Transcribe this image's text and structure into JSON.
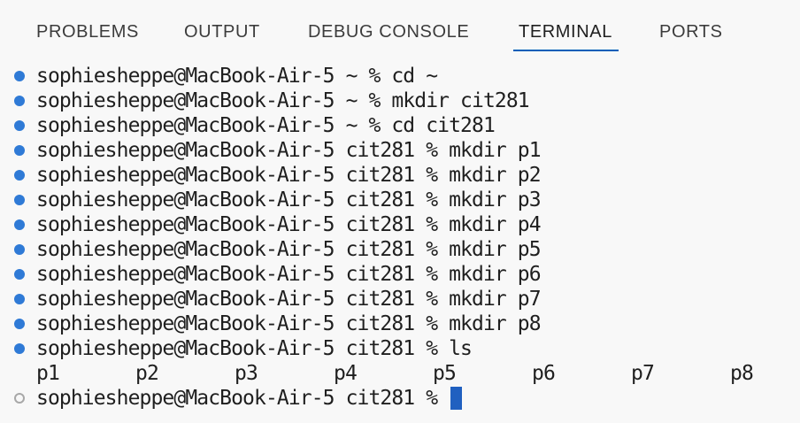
{
  "tabs": [
    {
      "label": "PROBLEMS"
    },
    {
      "label": "OUTPUT"
    },
    {
      "label": "DEBUG CONSOLE"
    },
    {
      "label": "TERMINAL",
      "active": true
    },
    {
      "label": "PORTS"
    }
  ],
  "terminal": {
    "lines": [
      "sophiesheppe@MacBook-Air-5 ~ % cd ~",
      "sophiesheppe@MacBook-Air-5 ~ % mkdir cit281",
      "sophiesheppe@MacBook-Air-5 ~ % cd cit281",
      "sophiesheppe@MacBook-Air-5 cit281 % mkdir p1",
      "sophiesheppe@MacBook-Air-5 cit281 % mkdir p2",
      "sophiesheppe@MacBook-Air-5 cit281 % mkdir p3",
      "sophiesheppe@MacBook-Air-5 cit281 % mkdir p4",
      "sophiesheppe@MacBook-Air-5 cit281 % mkdir p5",
      "sophiesheppe@MacBook-Air-5 cit281 % mkdir p6",
      "sophiesheppe@MacBook-Air-5 cit281 % mkdir p7",
      "sophiesheppe@MacBook-Air-5 cit281 % mkdir p8",
      "sophiesheppe@MacBook-Air-5 cit281 % ls"
    ],
    "ls_output": [
      "p1",
      "p2",
      "p3",
      "p4",
      "p5",
      "p6",
      "p7",
      "p8"
    ],
    "prompt": "sophiesheppe@MacBook-Air-5 cit281 % "
  },
  "colors": {
    "active_tab_underline": "#005fb8",
    "decoration_success": "#2f7ad6",
    "cursor": "#2060c0"
  }
}
